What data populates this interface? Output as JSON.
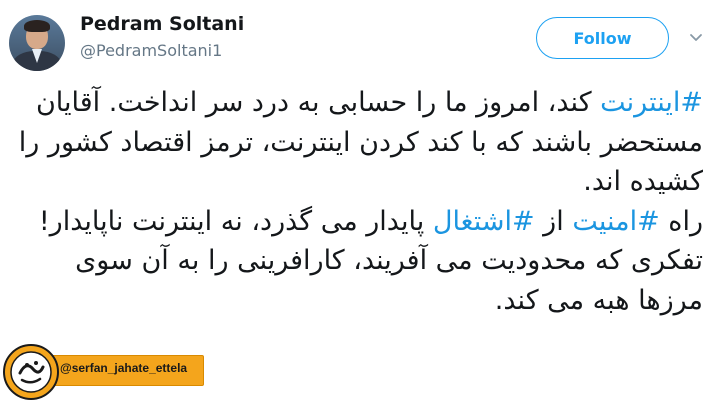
{
  "user": {
    "display_name": "Pedram Soltani",
    "handle": "@PedramSoltani1",
    "avatar_icon": "profile-photo"
  },
  "follow_label": "Follow",
  "caret_icon": "chevron-down-icon",
  "tweet": {
    "paragraph_1": {
      "hashtag": "#اینترنت",
      "text": " کند، امروز ما را حسابی به درد سر انداخت. آقایان مستحضر باشند که با کند کردن اینترنت، ترمز اقتصاد کشور را کشیده اند."
    },
    "paragraph_2": {
      "part_1": "راه ",
      "hashtag_1": "#امنیت",
      "part_2": " از ",
      "hashtag_2": "#اشتغال",
      "part_3": " پایدار می گذرد، نه اینترنت ناپایدار!"
    },
    "paragraph_3": "تفکری که محدودیت می آفریند، کارافرینی را به آن سوی مرزها هبه می کند."
  },
  "watermark": {
    "handle": "@serfan_jahate_ettela",
    "logo_icon": "channel-logo"
  },
  "colors": {
    "accent": "#1da1f2",
    "hashtag": "#1b95e0",
    "watermark_bar": "#f4a51c"
  }
}
